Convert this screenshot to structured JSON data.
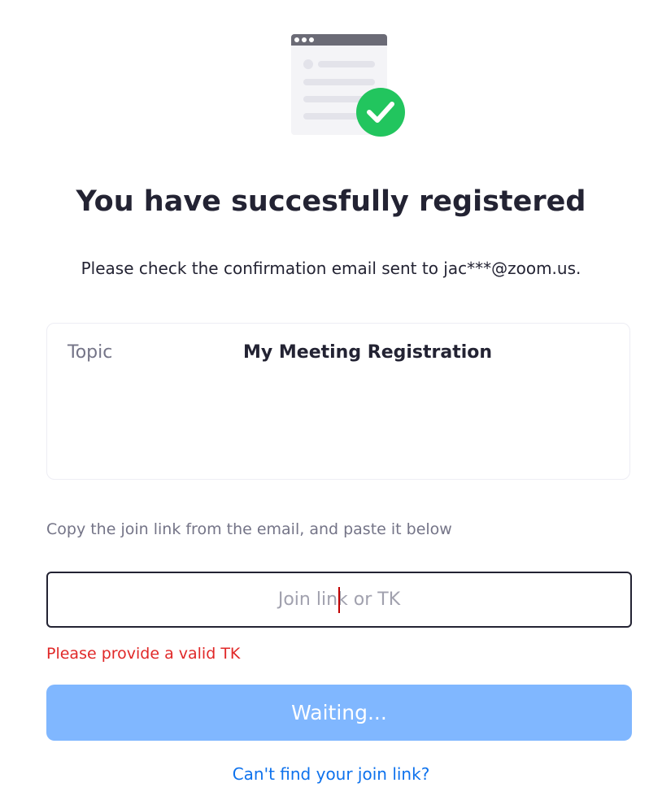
{
  "illustration": {
    "icon": "registration-success-icon",
    "check_color": "#22c55e"
  },
  "header": {
    "title": "You have succesfully registered",
    "subtitle": "Please check the confirmation email sent to jac***@zoom.us."
  },
  "topic_card": {
    "label": "Topic",
    "value": "My Meeting Registration"
  },
  "join": {
    "instruction": "Copy the join link from the email, and paste it below",
    "placeholder": "Join link or TK",
    "value": "",
    "error": "Please provide a valid TK",
    "button_label": "Waiting...",
    "help_link": "Can't find your join link?"
  },
  "colors": {
    "accent": "#0e72ed",
    "button_disabled": "#80b7ff",
    "error": "#e02828"
  }
}
